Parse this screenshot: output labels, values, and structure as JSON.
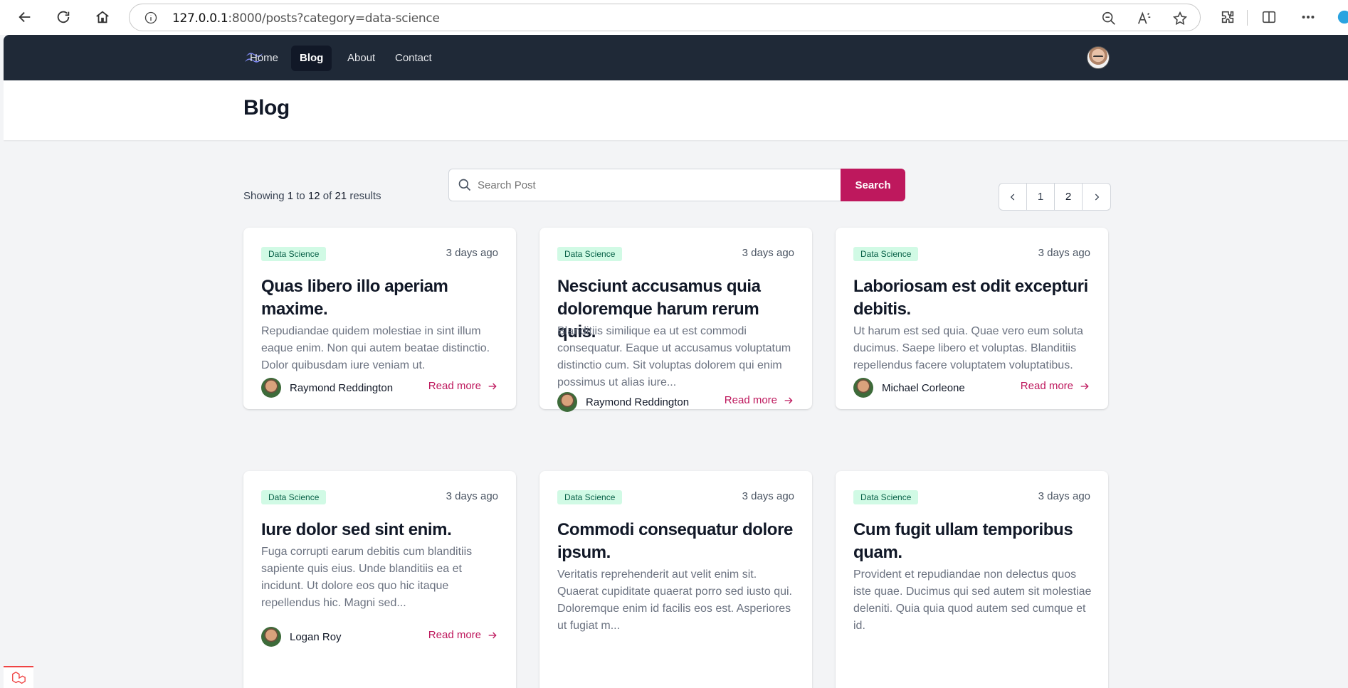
{
  "browser": {
    "url_host": "127.0.0.1",
    "url_rest": ":8000/posts?category=data-science"
  },
  "nav": {
    "items": [
      {
        "label": "Home",
        "active": false
      },
      {
        "label": "Blog",
        "active": true
      },
      {
        "label": "About",
        "active": false
      },
      {
        "label": "Contact",
        "active": false
      }
    ]
  },
  "page": {
    "title": "Blog"
  },
  "search": {
    "placeholder": "Search Post",
    "button_label": "Search"
  },
  "results": {
    "prefix": "Showing",
    "from": "1",
    "to_word": "to",
    "to": "12",
    "of_word": "of",
    "total": "21",
    "suffix": "results"
  },
  "pagination": {
    "pages": [
      "1",
      "2"
    ]
  },
  "posts": [
    {
      "category": "Data Science",
      "date": "3 days ago",
      "title": "Quas libero illo aperiam maxime.",
      "excerpt": "Repudiandae quidem molestiae in sint illum eaque enim. Non qui autem beatae distinctio. Dolor quibusdam iure veniam ut.",
      "author": "Raymond Reddington",
      "read_more": "Read more"
    },
    {
      "category": "Data Science",
      "date": "3 days ago",
      "title": "Nesciunt accusamus quia doloremque harum rerum quis.",
      "excerpt": "Blanditiis similique ea ut est commodi consequatur. Eaque ut accusamus voluptatum distinctio cum. Sit voluptas dolorem qui enim possimus ut alias iure...",
      "author": "Raymond Reddington",
      "read_more": "Read more"
    },
    {
      "category": "Data Science",
      "date": "3 days ago",
      "title": "Laboriosam est odit excepturi debitis.",
      "excerpt": "Ut harum est sed quia. Quae vero eum soluta ducimus. Saepe libero et voluptas. Blanditiis repellendus facere voluptatem voluptatibus.",
      "author": "Michael Corleone",
      "read_more": "Read more"
    },
    {
      "category": "Data Science",
      "date": "3 days ago",
      "title": "Iure dolor sed sint enim.",
      "excerpt": "Fuga corrupti earum debitis cum blanditiis sapiente quis eius. Unde blanditiis ea et incidunt. Ut dolore eos quo hic itaque repellendus hic. Magni sed...",
      "author": "Logan Roy",
      "read_more": "Read more"
    },
    {
      "category": "Data Science",
      "date": "3 days ago",
      "title": "Commodi consequatur dolore ipsum.",
      "excerpt": "Veritatis reprehenderit aut velit enim sit. Quaerat cupiditate quaerat porro sed iusto qui. Doloremque enim id facilis eos est. Asperiores ut fugiat m...",
      "author": "",
      "read_more": ""
    },
    {
      "category": "Data Science",
      "date": "3 days ago",
      "title": "Cum fugit ullam temporibus quam.",
      "excerpt": "Provident et repudiandae non delectus quos iste quae. Ducimus qui sed autem sit molestiae deleniti. Quia quia quod autem sed cumque et id.",
      "author": "",
      "read_more": ""
    }
  ],
  "colors": {
    "accent": "#be185d",
    "nav_bg": "#1f2937",
    "badge_bg": "#d1fae5"
  }
}
